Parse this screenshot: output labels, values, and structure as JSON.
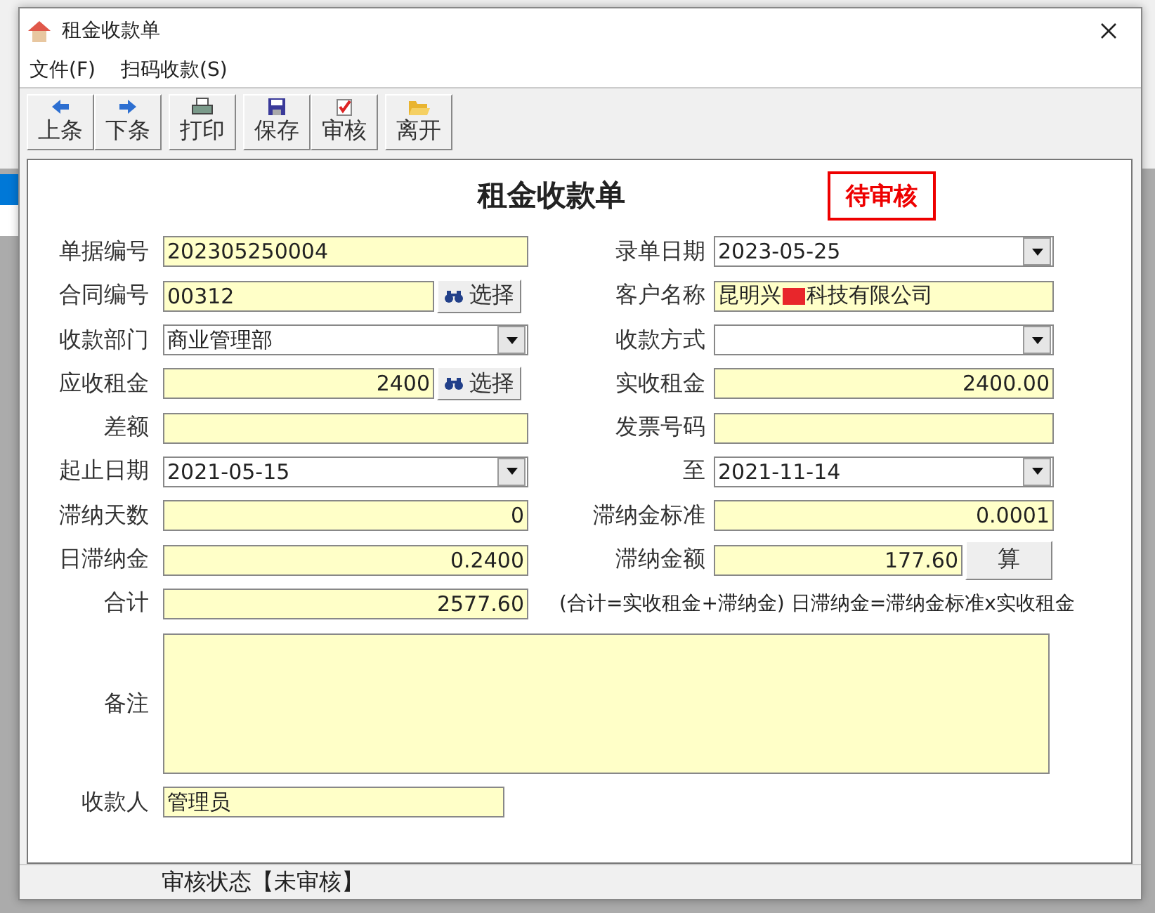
{
  "window": {
    "title": "租金收款单"
  },
  "menu": [
    {
      "label": "文件(F)"
    },
    {
      "label": "扫码收款(S)"
    }
  ],
  "toolbar": [
    {
      "label": "上条",
      "kind": "prev"
    },
    {
      "label": "下条",
      "kind": "next"
    },
    {
      "label": "打印",
      "kind": "print"
    },
    {
      "label": "保存",
      "kind": "save"
    },
    {
      "label": "审核",
      "kind": "audit"
    },
    {
      "label": "离开",
      "kind": "exit"
    }
  ],
  "form": {
    "title": "租金收款单",
    "status_badge": "待审核",
    "rows": [
      {
        "left": {
          "label": "单据编号",
          "kind": "text",
          "value": "202305250004"
        },
        "right": {
          "label": "录单日期",
          "kind": "combo",
          "value": "2023-05-25"
        }
      },
      {
        "left": {
          "label": "合同编号",
          "kind": "lookup",
          "value": "00312",
          "button": "选择"
        },
        "right": {
          "label": "客户名称",
          "kind": "redacted",
          "value_parts": [
            "昆明兴",
            "科技有限公司"
          ]
        }
      },
      {
        "left": {
          "label": "收款部门",
          "kind": "combo",
          "value": "商业管理部"
        },
        "right": {
          "label": "收款方式",
          "kind": "combo"
        }
      },
      {
        "left": {
          "label": "应收租金",
          "kind": "number_lookup",
          "value": "2400",
          "button": "选择"
        },
        "right": {
          "label": "实收租金",
          "kind": "number",
          "value": "2400.00"
        }
      },
      {
        "left": {
          "label": "差额",
          "kind": "text"
        },
        "right": {
          "label": "发票号码",
          "kind": "text"
        }
      },
      {
        "left": {
          "label": "起止日期",
          "kind": "combo",
          "value": "2021-05-15"
        },
        "right": {
          "label": "至",
          "kind": "combo",
          "value": "2021-11-14"
        }
      },
      {
        "left": {
          "label": "滞纳天数",
          "kind": "number",
          "value": "0"
        },
        "right": {
          "label": "滞纳金标准",
          "kind": "number",
          "value": "0.0001"
        }
      },
      {
        "left": {
          "label": "日滞纳金",
          "kind": "number",
          "value": "0.2400"
        },
        "right": {
          "label": "滞纳金额",
          "kind": "number_calc",
          "value": "177.60",
          "button": "算"
        }
      },
      {
        "left": {
          "label": "合计",
          "kind": "number",
          "value": "2577.60"
        },
        "note": "(合计=实收租金+滞纳金) 日滞纳金=滞纳金标准x实收租金"
      }
    ],
    "remarks": {
      "label": "备注"
    },
    "payee": {
      "label": "收款人",
      "value": "管理员"
    }
  },
  "status_bar": "审核状态【未审核】"
}
